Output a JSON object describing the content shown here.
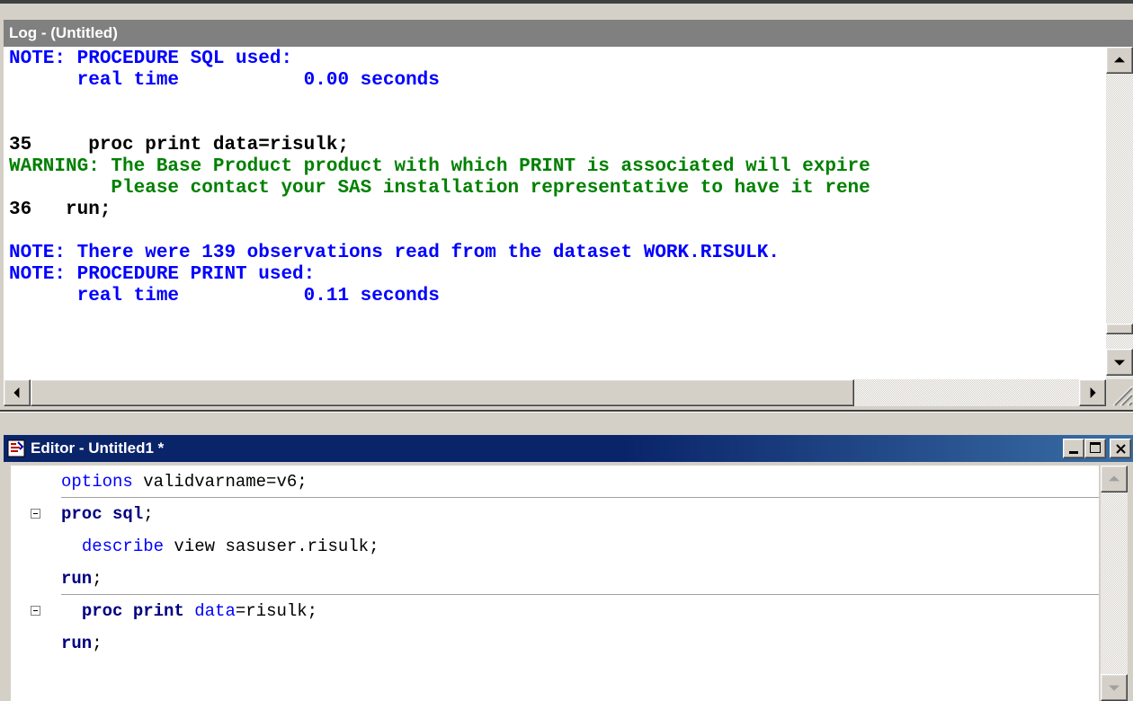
{
  "log_window": {
    "title": "Log - (Untitled)",
    "lines": [
      {
        "text": "NOTE: PROCEDURE SQL used:",
        "color": "#0000ff"
      },
      {
        "text": "      real time           0.00 seconds",
        "color": "#0000ff"
      },
      {
        "text": "",
        "color": "#000000"
      },
      {
        "text": "",
        "color": "#000000"
      },
      {
        "text": "35     proc print data=risulk;",
        "color": "#000000"
      },
      {
        "text": "WARNING: The Base Product product with which PRINT is associated will expire",
        "color": "#008000"
      },
      {
        "text": "         Please contact your SAS installation representative to have it rene",
        "color": "#008000"
      },
      {
        "text": "36   run;",
        "color": "#000000"
      },
      {
        "text": "",
        "color": "#000000"
      },
      {
        "text": "NOTE: There were 139 observations read from the dataset WORK.RISULK.",
        "color": "#0000ff"
      },
      {
        "text": "NOTE: PROCEDURE PRINT used:",
        "color": "#0000ff"
      },
      {
        "text": "      real time           0.11 seconds",
        "color": "#0000ff"
      }
    ]
  },
  "editor_window": {
    "title": "Editor - Untitled1 *",
    "icon": "sas-editor-icon",
    "controls": {
      "minimize": "minimize-icon",
      "maximize": "maximize-icon",
      "close": "close-icon"
    },
    "lines": [
      {
        "fold": false,
        "indent": "",
        "tokens": [
          {
            "t": "options",
            "c": "#0000ff"
          },
          {
            "t": " validvarname=v6;",
            "c": "#000000"
          }
        ]
      },
      {
        "fold": true,
        "indent": "",
        "tokens": [
          {
            "t": "proc sql",
            "c": "#000080",
            "b": true
          },
          {
            "t": ";",
            "c": "#000000"
          }
        ]
      },
      {
        "fold": false,
        "indent": "  ",
        "tokens": [
          {
            "t": "describe",
            "c": "#0000ff"
          },
          {
            "t": " view sasuser.risulk;",
            "c": "#000000"
          }
        ]
      },
      {
        "fold": false,
        "indent": "",
        "tokens": [
          {
            "t": "run",
            "c": "#000080",
            "b": true
          },
          {
            "t": ";",
            "c": "#000000"
          }
        ]
      },
      {
        "fold": true,
        "indent": "  ",
        "tokens": [
          {
            "t": "proc print",
            "c": "#000080",
            "b": true
          },
          {
            "t": " data",
            "c": "#0000ff"
          },
          {
            "t": "=risulk;",
            "c": "#000000"
          }
        ]
      },
      {
        "fold": false,
        "indent": "",
        "tokens": [
          {
            "t": "run",
            "c": "#000080",
            "b": true
          },
          {
            "t": ";",
            "c": "#000000"
          }
        ]
      }
    ]
  }
}
